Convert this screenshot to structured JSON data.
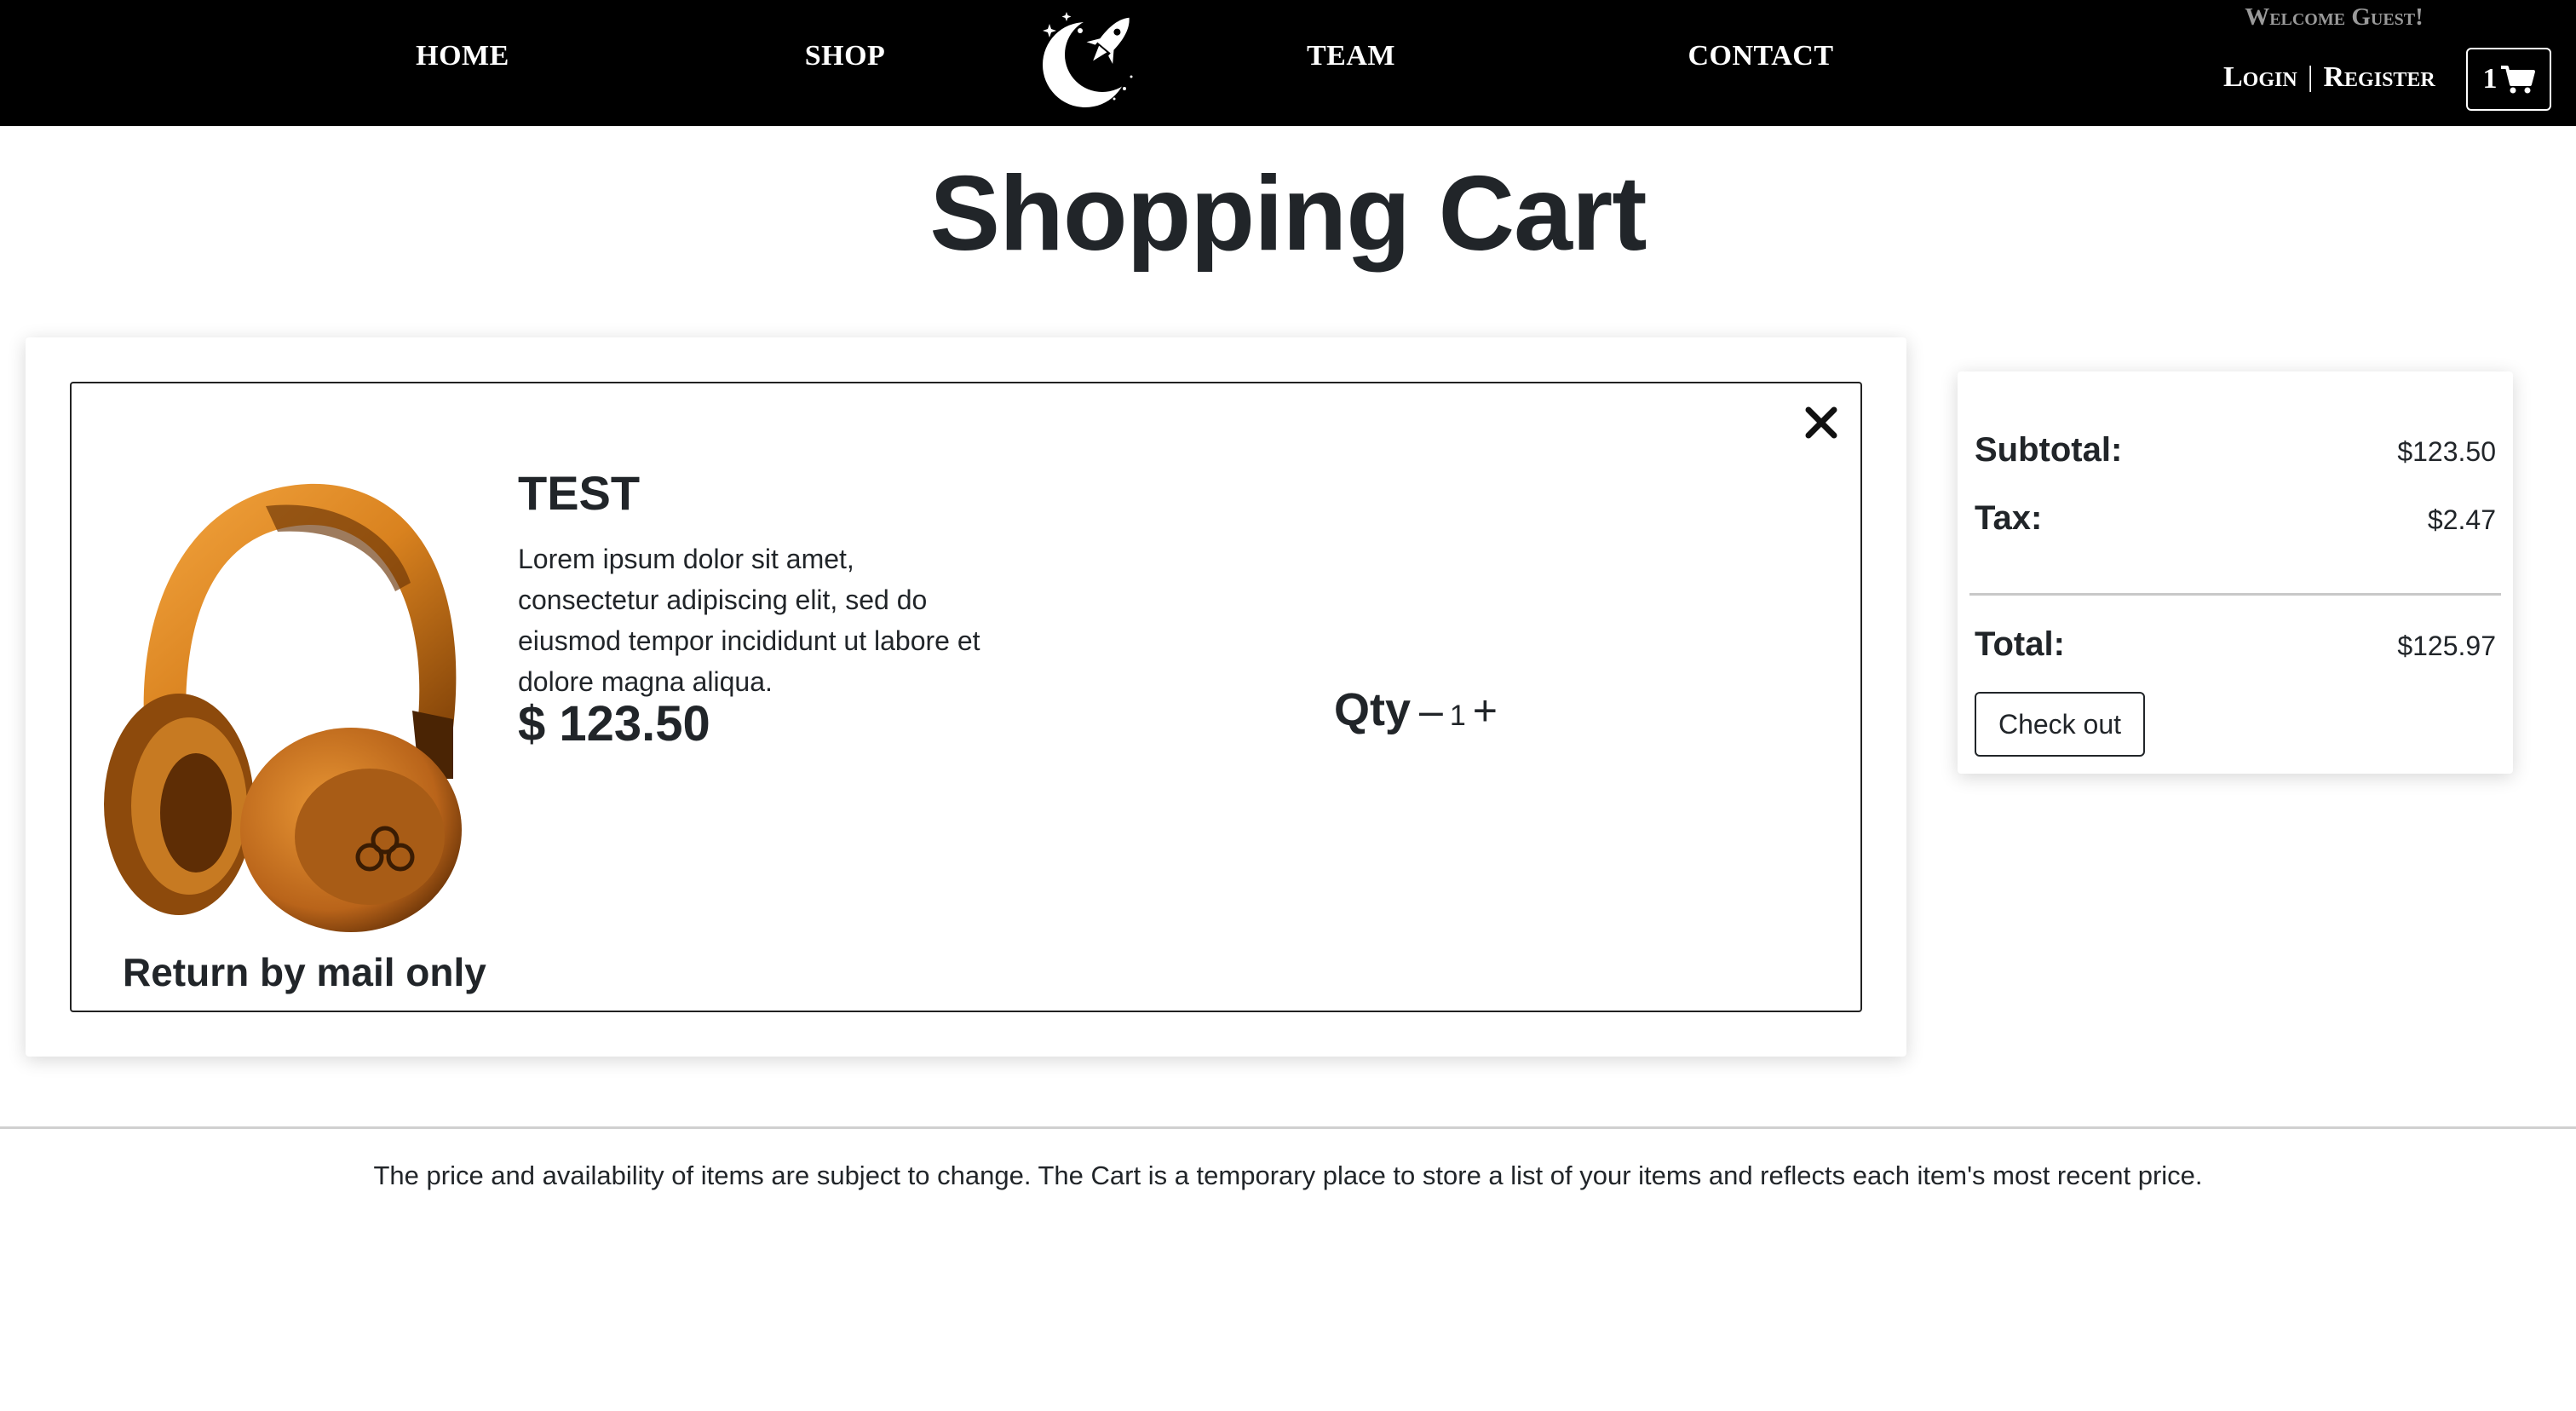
{
  "nav": {
    "home": "Home",
    "shop": "Shop",
    "team": "Team",
    "contact": "Contact",
    "welcome": "Welcome Guest!",
    "login": "Login",
    "separator": "|",
    "register": "Register",
    "cart_count": "1"
  },
  "page": {
    "title": "Shopping Cart"
  },
  "cart": {
    "item": {
      "name": "TEST",
      "description": "Lorem ipsum dolor sit amet, consectetur adipiscing elit, sed do eiusmod tempor incididunt ut labore et dolore magna aliqua.",
      "price": "$ 123.50",
      "return_policy": "Return by mail only",
      "qty_label": "Qty",
      "qty_minus": "–",
      "qty_value": "1",
      "qty_plus": "+"
    }
  },
  "summary": {
    "subtotal_label": "Subtotal:",
    "subtotal_value": "$123.50",
    "tax_label": "Tax:",
    "tax_value": "$2.47",
    "total_label": "Total:",
    "total_value": "$125.97",
    "checkout_label": "Check out"
  },
  "footer": {
    "note": "The price and availability of items are subject to change. The Cart is a temporary place to store a list of your items and reflects each item's most recent price."
  },
  "icons": {
    "logo": "moon-rocket-logo",
    "cart": "shopping-cart-icon",
    "remove": "close-icon"
  },
  "colors": {
    "navbar_bg": "#000000",
    "text": "#212529",
    "headphone_orange": "#d9821f"
  }
}
